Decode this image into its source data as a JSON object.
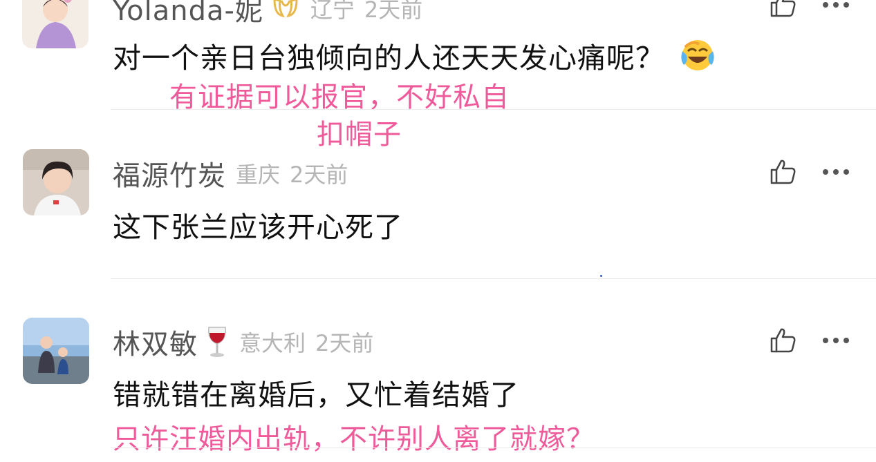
{
  "comments": [
    {
      "username": "Yolanda-妮",
      "location": "辽宁",
      "time": "2天前",
      "text": "对一个亲日台独倾向的人还天天发心痛呢？",
      "badge_icon": "gold-badge-icon",
      "emoji_icon": "laughing-crying-emoji-icon"
    },
    {
      "username": "福源竹炭",
      "location": "重庆",
      "time": "2天前",
      "text": "这下张兰应该开心死了"
    },
    {
      "username": "林双敏",
      "location": "意大利",
      "time": "2天前",
      "text": "错就错在离婚后，又忙着结婚了",
      "badge_icon": "wine-glass-icon"
    }
  ],
  "overlays": {
    "note1_line1": "有证据可以报官，不好私自",
    "note1_line2": "扣帽子",
    "note2": "只许汪婚内出轨，不许别人离了就嫁？"
  },
  "colors": {
    "overlay_pink": "#ef5a9a",
    "username_gray": "#555555",
    "meta_gray": "#b5b5b5",
    "comment_text": "#111111"
  },
  "icons": {
    "like": "thumbs-up-icon",
    "more": "more-dots-icon"
  }
}
